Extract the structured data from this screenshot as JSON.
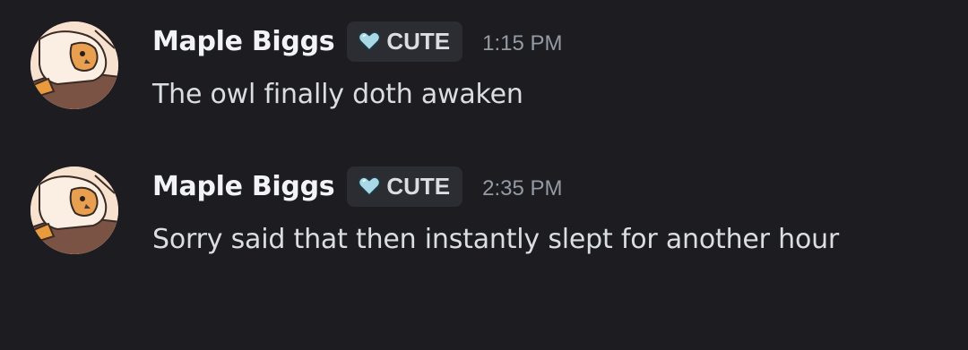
{
  "messages": [
    {
      "username": "Maple Biggs",
      "tag": {
        "icon": "heart-icon",
        "label": "CUTE"
      },
      "timestamp": "1:15 PM",
      "text": "The owl finally doth awaken",
      "avatar": "owl-avatar"
    },
    {
      "username": "Maple Biggs",
      "tag": {
        "icon": "heart-icon",
        "label": "CUTE"
      },
      "timestamp": "2:35 PM",
      "text": "Sorry said that then instantly slept for another hour",
      "avatar": "owl-avatar"
    }
  ],
  "colors": {
    "background": "#1c1c21",
    "username": "#f2f3f5",
    "text": "#dbdee1",
    "timestamp": "#949ba4",
    "tag_bg": "#2b2d33",
    "heart": "#a9d9e6"
  }
}
